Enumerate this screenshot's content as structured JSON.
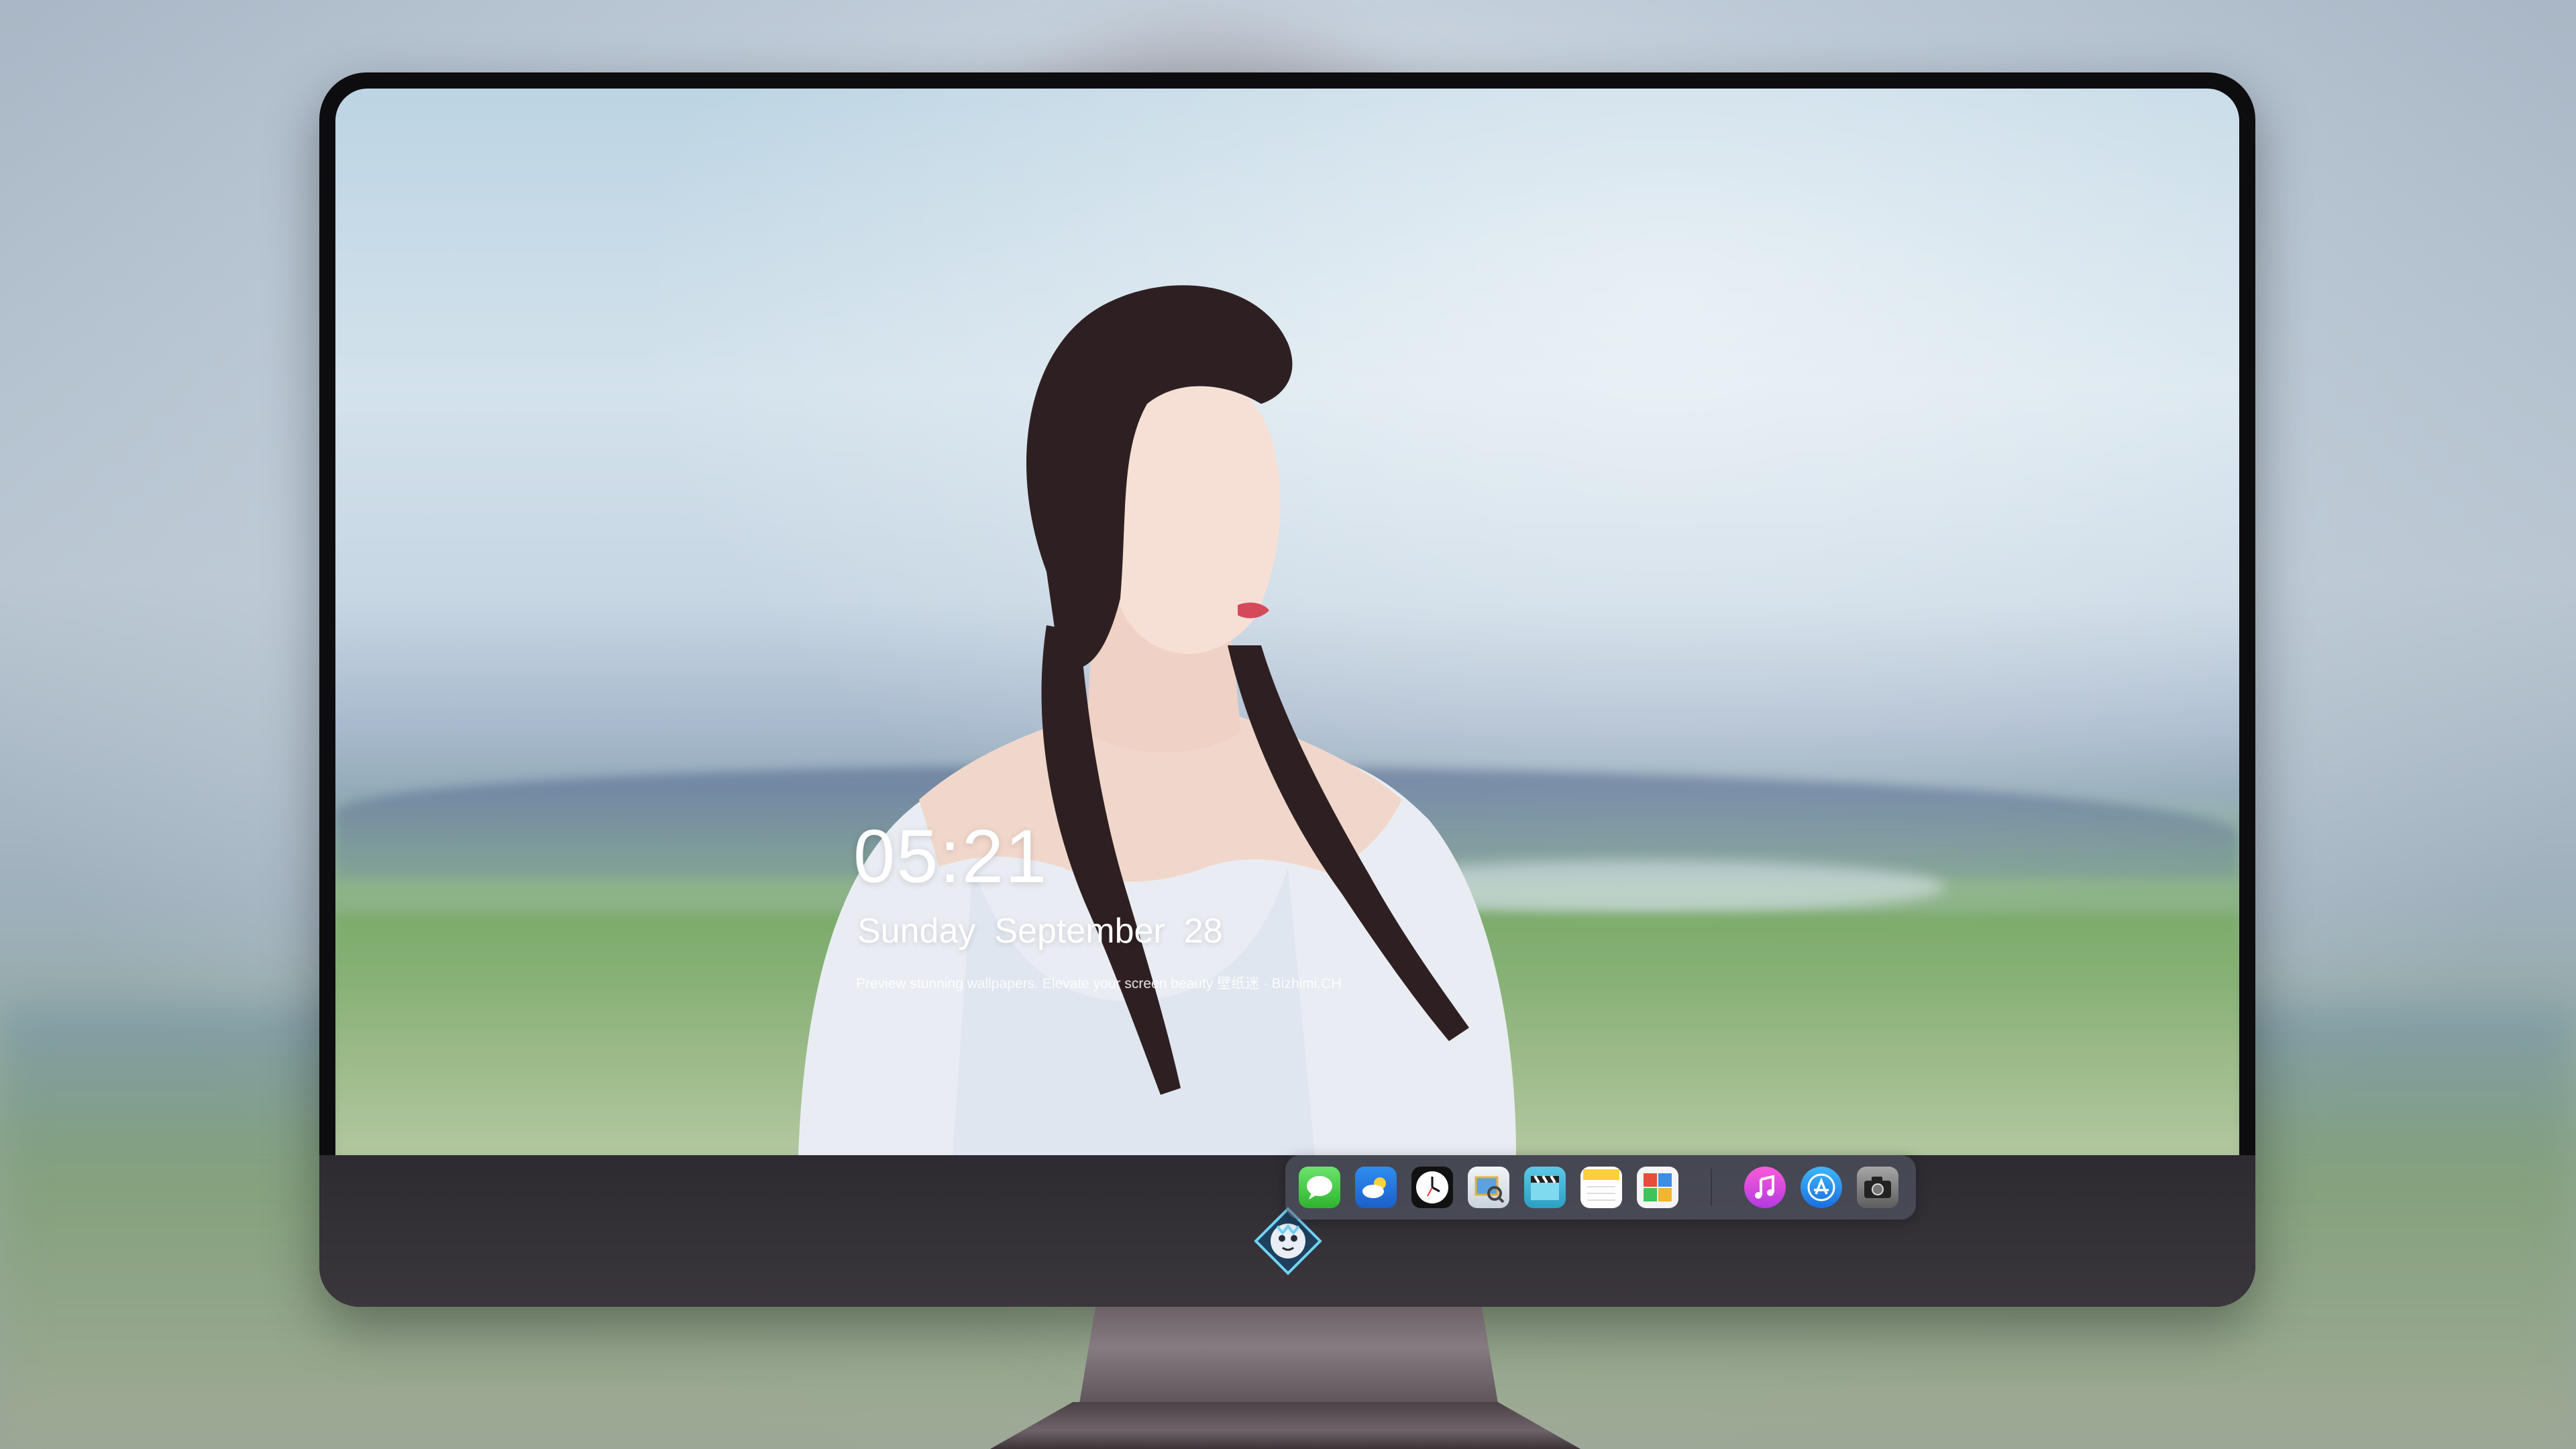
{
  "lockscreen": {
    "time": "05:21",
    "weekday": "Sunday",
    "month": "September",
    "day": "28",
    "tagline": "Preview stunning wallpapers. Elevate your screen beauty  壁纸迷 · Bizhimi.CH"
  },
  "dock": {
    "items": [
      {
        "id": "messages",
        "icon": "messages-icon"
      },
      {
        "id": "weather",
        "icon": "weather-icon"
      },
      {
        "id": "clock",
        "icon": "clock-icon"
      },
      {
        "id": "preview",
        "icon": "preview-icon"
      },
      {
        "id": "videos",
        "icon": "clapperboard-icon"
      },
      {
        "id": "notes",
        "icon": "notes-icon"
      },
      {
        "id": "photo-booth",
        "icon": "photo-collage-icon"
      },
      {
        "id": "music",
        "icon": "music-icon"
      },
      {
        "id": "app-store",
        "icon": "app-store-icon"
      },
      {
        "id": "camera",
        "icon": "camera-icon"
      }
    ]
  },
  "colors": {
    "dock_bg": "#5a5f6e",
    "bezel": "#0d0d0f",
    "chin": "#2d2b31"
  }
}
